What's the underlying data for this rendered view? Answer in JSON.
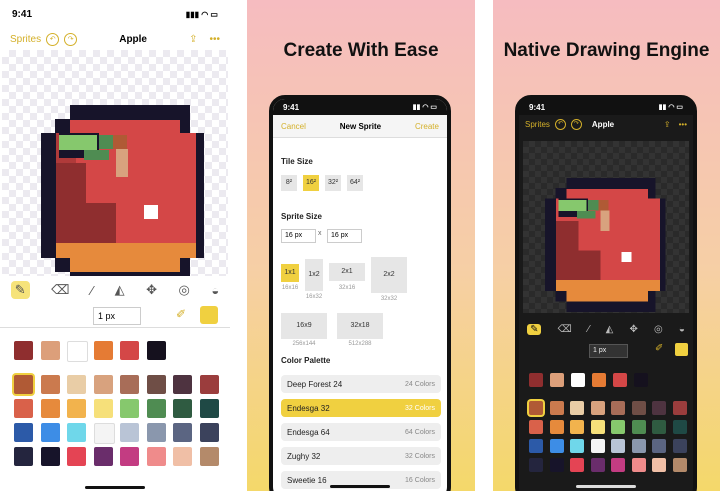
{
  "panel1": {
    "status": {
      "time": "9:41",
      "icons": "▮▮▮ ◠ ▭"
    },
    "nav": {
      "sprites_label": "Sprites",
      "title": "Apple"
    },
    "size_label": "1 px",
    "tools": [
      "pencil",
      "eraser",
      "eyedropper",
      "fill",
      "move",
      "shape",
      "more"
    ],
    "swatch_row1": [
      "#8f2e2f",
      "#dc9f7a",
      "#ffffff",
      "#e57b34",
      "#d44747",
      "#15111e"
    ],
    "swatch_grid": [
      [
        "#b05a35",
        "#cb7a4e",
        "#e9cda6",
        "#d8a27e",
        "#a86d58",
        "#6f4e46",
        "#4e3340",
        "#9b3d3d"
      ],
      [
        "#d9614a",
        "#e68a3c",
        "#f2b34d",
        "#f6e07a",
        "#86c86d",
        "#4f8c52",
        "#2f5b41",
        "#1f4945"
      ],
      [
        "#2c5aa8",
        "#3d8de6",
        "#6fd7ea",
        "#f4f4f4",
        "#b9c4d6",
        "#8a97ad",
        "#5b6582",
        "#3b425c"
      ],
      [
        "#24253e",
        "#17142a",
        "#e44454",
        "#6a2d6b",
        "#c33c82",
        "#ef8b8b",
        "#f0bfa6",
        "#b48a6a"
      ]
    ]
  },
  "panel2": {
    "headline": "Create With Ease",
    "status_time": "9:41",
    "nav": {
      "cancel": "Cancel",
      "title": "New Sprite",
      "create": "Create"
    },
    "tile_size_label": "Tile Size",
    "tiles": [
      "8²",
      "16²",
      "32²",
      "64²"
    ],
    "sprite_size_label": "Sprite Size",
    "width": "16 px",
    "x_label": "x",
    "height": "16 px",
    "layouts": [
      {
        "label": "1x1",
        "cap": "16x16"
      },
      {
        "label": "1x2",
        "cap": "16x32"
      },
      {
        "label": "2x1",
        "cap": "32x16"
      },
      {
        "label": "2x2",
        "cap": "32x32"
      },
      {
        "label": "16x9",
        "cap": "256x144"
      },
      {
        "label": "32x18",
        "cap": "512x288"
      }
    ],
    "palette_label": "Color Palette",
    "palettes": [
      {
        "name": "Deep Forest 24",
        "count": "24 Colors"
      },
      {
        "name": "Endesga 32",
        "count": "32 Colors"
      },
      {
        "name": "Endesga 64",
        "count": "64 Colors"
      },
      {
        "name": "Zughy 32",
        "count": "32 Colors"
      },
      {
        "name": "Sweetie 16",
        "count": "16 Colors"
      }
    ]
  },
  "panel3": {
    "headline": "Native Drawing Engine",
    "status_time": "9:41",
    "nav": {
      "sprites_label": "Sprites",
      "title": "Apple"
    },
    "size_label": "1 px"
  }
}
